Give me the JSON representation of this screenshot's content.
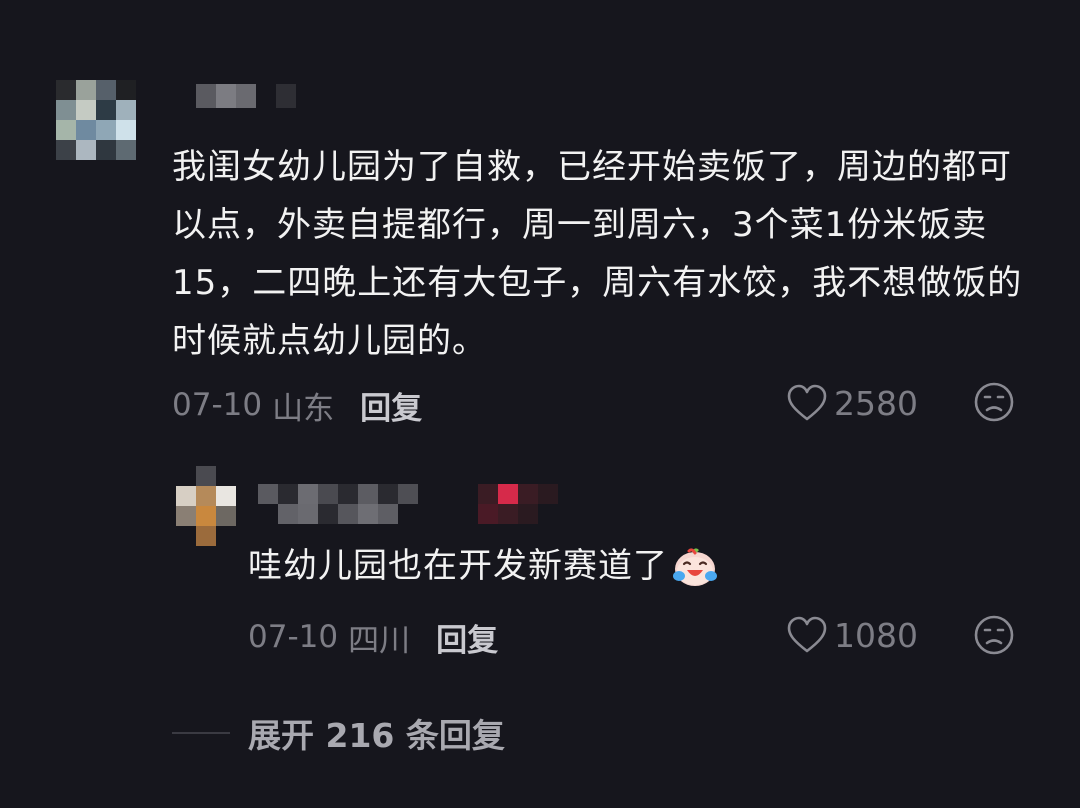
{
  "comment": {
    "text": "我闺女幼儿园为了自救，已经开始卖饭了，周边的都可以点，外卖自提都行，周一到周六，3个菜1份米饭卖15，二四晚上还有大包子，周六有水饺，我不想做饭的时候就点幼儿园的。",
    "date": "07-10",
    "region": "山东",
    "reply_label": "回复",
    "likes": "2580"
  },
  "reply": {
    "text": "哇幼儿园也在开发新赛道了",
    "emoji_icon": "crying-laughing-emoji",
    "date": "07-10",
    "region": "四川",
    "reply_label": "回复",
    "likes": "1080"
  },
  "expand": {
    "label": "展开 216 条回复"
  },
  "icons": {
    "like": "heart-outline-icon",
    "dislike": "frown-face-icon"
  },
  "colors": {
    "background": "#16161d",
    "text_primary": "#f2f2f2",
    "text_meta": "#7d7d85",
    "reply_button": "#c9c9cf"
  }
}
